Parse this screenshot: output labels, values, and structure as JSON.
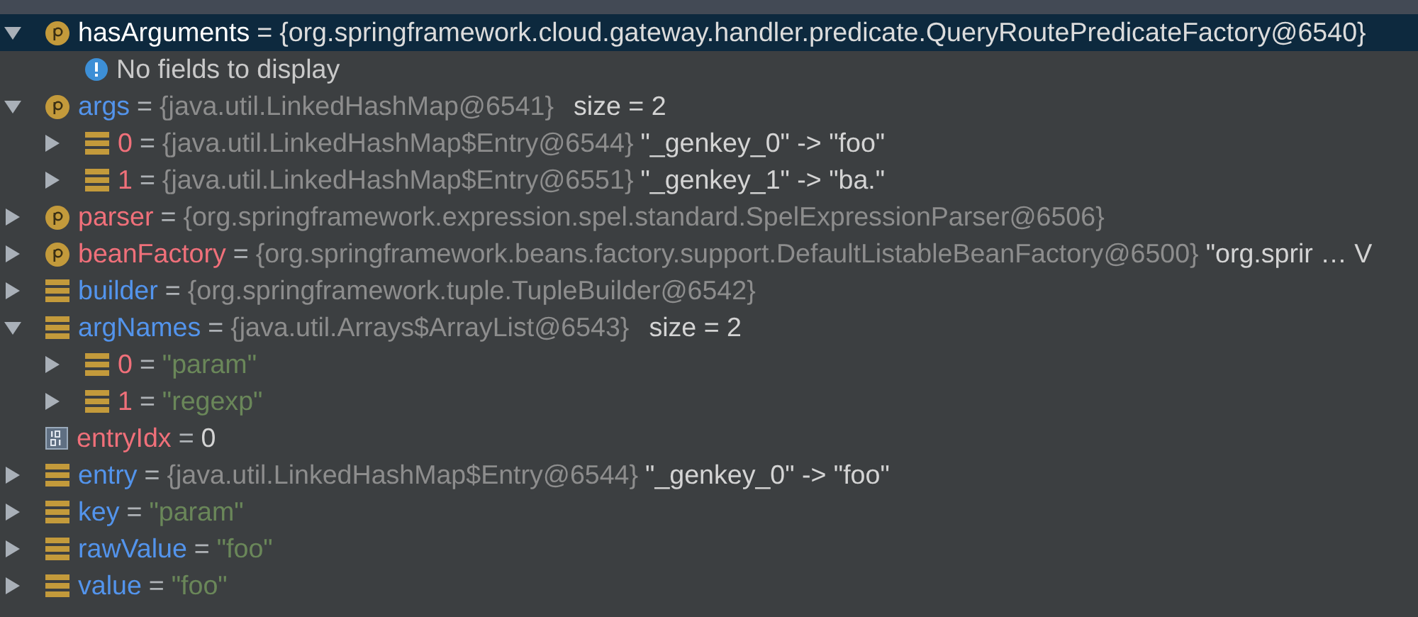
{
  "variables": [
    {
      "kind": "property",
      "name": "hasArguments",
      "color": "#ffffff",
      "selected": true,
      "expanded": true,
      "parts": [
        {
          "kind": "op",
          "text": "="
        },
        {
          "kind": "ref",
          "text": "{org.springframework.cloud.gateway.handler.predicate.QueryRoutePredicateFactory@6540}"
        }
      ],
      "children": [
        {
          "kind": "info",
          "message": "No fields to display",
          "selected": false
        }
      ]
    },
    {
      "kind": "property",
      "name": "args",
      "color": "#5394ec",
      "selected": false,
      "expanded": true,
      "parts": [
        {
          "kind": "op",
          "text": "="
        },
        {
          "kind": "ref",
          "text": "{java.util.LinkedHashMap@6541}"
        },
        {
          "kind": "extra",
          "text": "size = 2"
        }
      ],
      "children": [
        {
          "kind": "field",
          "name": "0",
          "color": "#f0707a",
          "selected": false,
          "expanded": false,
          "parts": [
            {
              "kind": "op",
              "text": "="
            },
            {
              "kind": "ref",
              "text": "{java.util.LinkedHashMap$Entry@6544}"
            },
            {
              "kind": "plain",
              "text": "\"_genkey_0\" -> \"foo\""
            }
          ]
        },
        {
          "kind": "field",
          "name": "1",
          "color": "#f0707a",
          "selected": false,
          "expanded": false,
          "parts": [
            {
              "kind": "op",
              "text": "="
            },
            {
              "kind": "ref",
              "text": "{java.util.LinkedHashMap$Entry@6551}"
            },
            {
              "kind": "plain",
              "text": "\"_genkey_1\" -> \"ba.\""
            }
          ]
        }
      ]
    },
    {
      "kind": "property",
      "name": "parser",
      "color": "#f0707a",
      "selected": false,
      "expanded": false,
      "parts": [
        {
          "kind": "op",
          "text": "="
        },
        {
          "kind": "ref",
          "text": "{org.springframework.expression.spel.standard.SpelExpressionParser@6506}"
        }
      ]
    },
    {
      "kind": "property",
      "name": "beanFactory",
      "color": "#f0707a",
      "selected": false,
      "expanded": false,
      "parts": [
        {
          "kind": "op",
          "text": "="
        },
        {
          "kind": "ref",
          "text": "{org.springframework.beans.factory.support.DefaultListableBeanFactory@6500}"
        },
        {
          "kind": "plain",
          "text": "\"org.sprir … V"
        }
      ]
    },
    {
      "kind": "field",
      "name": "builder",
      "color": "#5394ec",
      "selected": false,
      "expanded": false,
      "parts": [
        {
          "kind": "op",
          "text": "="
        },
        {
          "kind": "ref",
          "text": "{org.springframework.tuple.TupleBuilder@6542}"
        }
      ]
    },
    {
      "kind": "field",
      "name": "argNames",
      "color": "#5394ec",
      "selected": false,
      "expanded": true,
      "parts": [
        {
          "kind": "op",
          "text": "="
        },
        {
          "kind": "ref",
          "text": "{java.util.Arrays$ArrayList@6543}"
        },
        {
          "kind": "extra",
          "text": "size = 2"
        }
      ],
      "children": [
        {
          "kind": "field",
          "name": "0",
          "color": "#f0707a",
          "selected": false,
          "expanded": false,
          "parts": [
            {
              "kind": "op",
              "text": "="
            },
            {
              "kind": "string",
              "text": "\"param\""
            }
          ]
        },
        {
          "kind": "field",
          "name": "1",
          "color": "#f0707a",
          "selected": false,
          "expanded": false,
          "parts": [
            {
              "kind": "op",
              "text": "="
            },
            {
              "kind": "string",
              "text": "\"regexp\""
            }
          ]
        }
      ]
    },
    {
      "kind": "primitive",
      "name": "entryIdx",
      "color": "#f0707a",
      "selected": false,
      "parts": [
        {
          "kind": "op",
          "text": "="
        },
        {
          "kind": "plain",
          "text": "0"
        }
      ]
    },
    {
      "kind": "field",
      "name": "entry",
      "color": "#5394ec",
      "selected": false,
      "expanded": false,
      "parts": [
        {
          "kind": "op",
          "text": "="
        },
        {
          "kind": "ref",
          "text": "{java.util.LinkedHashMap$Entry@6544}"
        },
        {
          "kind": "plain",
          "text": "\"_genkey_0\" -> \"foo\""
        }
      ]
    },
    {
      "kind": "field",
      "name": "key",
      "color": "#5394ec",
      "selected": false,
      "expanded": false,
      "parts": [
        {
          "kind": "op",
          "text": "="
        },
        {
          "kind": "string",
          "text": "\"param\""
        }
      ]
    },
    {
      "kind": "field",
      "name": "rawValue",
      "color": "#5394ec",
      "selected": false,
      "expanded": false,
      "parts": [
        {
          "kind": "op",
          "text": "="
        },
        {
          "kind": "string",
          "text": "\"foo\""
        }
      ]
    },
    {
      "kind": "field",
      "name": "value",
      "color": "#5394ec",
      "selected": false,
      "expanded": false,
      "parts": [
        {
          "kind": "op",
          "text": "="
        },
        {
          "kind": "string",
          "text": "\"foo\""
        }
      ]
    }
  ]
}
